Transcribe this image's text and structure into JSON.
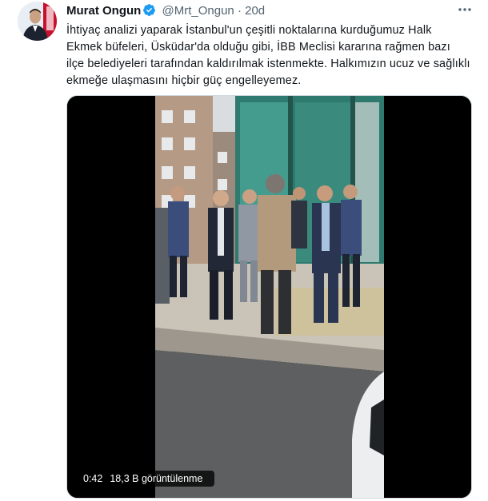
{
  "tweet": {
    "author": {
      "name": "Murat Ongun",
      "handle": "@Mrt_Ongun",
      "verified": true,
      "avatar_icon": "profile-photo"
    },
    "separator": "·",
    "timestamp": "20d",
    "text_lines": [
      "İhtiyaç analizi yaparak İstanbul'un çeşitli noktalarına kurduğumuz Halk",
      "Ekmek büfeleri, Üsküdar'da olduğu gibi, İBB Meclisi kararına rağmen bazı",
      "ilçe belediyeleri tarafından kaldırılmak istenmekte. Halkımızın ucuz ve sağlıklı",
      "ekmeğe ulaşmasını hiçbir güç engelleyemez."
    ],
    "video": {
      "duration": "0:42",
      "views": "18,3 B görüntülenme"
    }
  },
  "colors": {
    "verified_badge": "#1d9bf0",
    "secondary_text": "#536471",
    "primary_text": "#0f1419"
  }
}
